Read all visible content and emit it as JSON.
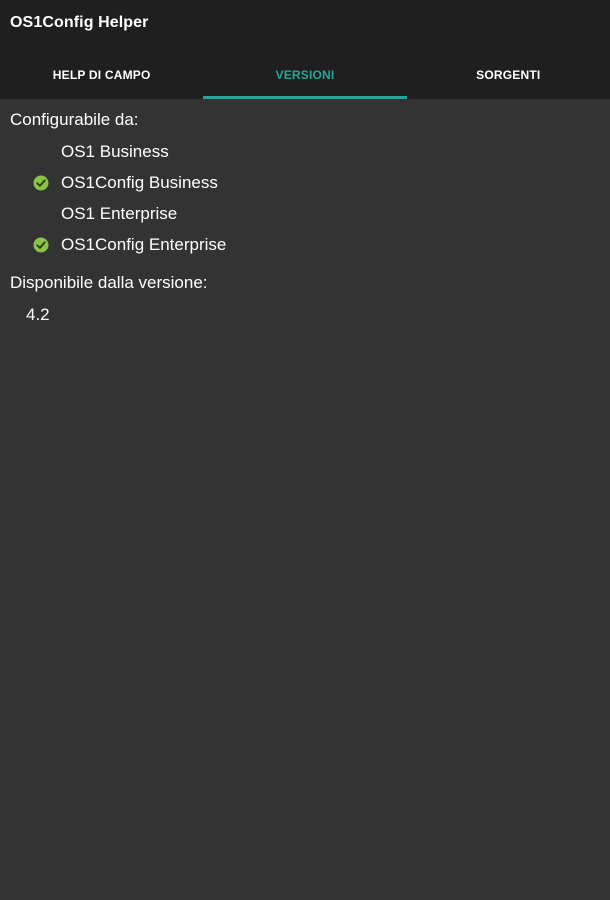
{
  "app": {
    "title": "OS1Config Helper"
  },
  "tabs": [
    {
      "label": "HELP DI CAMPO",
      "active": false
    },
    {
      "label": "VERSIONI",
      "active": true
    },
    {
      "label": "SORGENTI",
      "active": false
    }
  ],
  "content": {
    "configurable_label": "Configurabile da:",
    "configurable_items": [
      {
        "label": "OS1 Business",
        "checked": false
      },
      {
        "label": "OS1Config Business",
        "checked": true
      },
      {
        "label": "OS1 Enterprise",
        "checked": false
      },
      {
        "label": "OS1Config Enterprise",
        "checked": true
      }
    ],
    "available_label": "Disponibile dalla versione:",
    "available_version": "4.2"
  },
  "colors": {
    "background": "#333333",
    "bar": "#1f1f1f",
    "accent": "#26a69a",
    "check": "#8bc34a"
  },
  "icons": {
    "checked": "check-circle-icon"
  }
}
